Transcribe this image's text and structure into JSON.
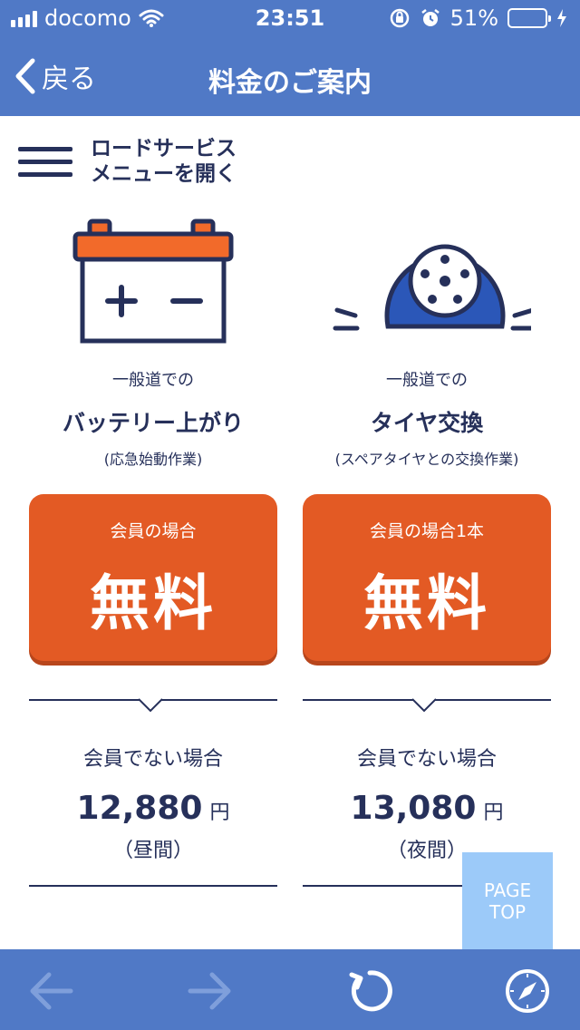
{
  "status_bar": {
    "carrier": "docomo",
    "time": "23:51",
    "battery_percent": "51%",
    "battery_level": 0.51
  },
  "nav": {
    "back_label": "戻る",
    "title": "料金のご案内"
  },
  "menu": {
    "line1": "ロードサービス",
    "line2": "メニューを開く"
  },
  "services": [
    {
      "illustration": "car-battery-icon",
      "subtitle": "一般道での",
      "name": "バッテリー上がり",
      "note": "(応急始動作業)",
      "member_label": "会員の場合",
      "member_price": "無料",
      "nonmember_label": "会員でない場合",
      "nonmember_price": "12,880",
      "currency": "円",
      "time_of_day": "（昼間）"
    },
    {
      "illustration": "flat-tire-icon",
      "subtitle": "一般道での",
      "name": "タイヤ交換",
      "note": "(スペアタイヤとの交換作業)",
      "member_label": "会員の場合1本",
      "member_price": "無料",
      "nonmember_label": "会員でない場合",
      "nonmember_price": "13,080",
      "currency": "円",
      "time_of_day": "（夜間）"
    }
  ],
  "page_top": {
    "line1": "PAGE",
    "line2": "TOP"
  },
  "toolbar": {
    "icons": [
      "arrow-left-icon",
      "arrow-right-icon",
      "reload-icon",
      "compass-icon"
    ]
  },
  "colors": {
    "header_blue": "#5079c6",
    "accent_orange": "#e35a24",
    "text_navy": "#26305a",
    "page_top_blue": "#9ccaf9"
  }
}
